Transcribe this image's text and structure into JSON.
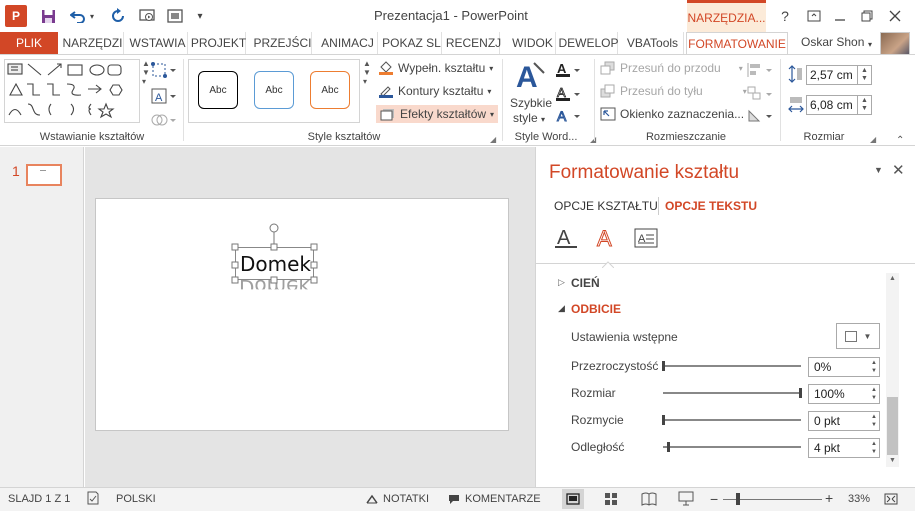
{
  "app": {
    "title": "Prezentacja1 - PowerPoint",
    "icon_letter": "P",
    "accent_color": "#d24726"
  },
  "titlebar": {
    "context_tab_header": "NARZĘDZIA...",
    "help_icon": "?",
    "user": "Oskar Shon"
  },
  "tabs": {
    "file": "PLIK",
    "items": [
      "NARZĘDZI",
      "WSTAWIA",
      "PROJEKT",
      "PRZEJŚCI",
      "ANIMACJ",
      "POKAZ SL",
      "RECENZJ",
      "WIDOK",
      "DEWELOP",
      "VBATools",
      "FORMATOWANIE"
    ],
    "active": "FORMATOWANIE"
  },
  "ribbon": {
    "groups": {
      "insert_shapes": "Wstawianie kształtów",
      "shape_styles": "Style kształtów",
      "wordart": "Style Word...",
      "arrange": "Rozmieszczanie",
      "size": "Rozmiar"
    },
    "style_boxes": [
      "Abc",
      "Abc",
      "Abc"
    ],
    "style_colors": [
      "#000000",
      "#5b9bd5",
      "#ed7d31"
    ],
    "shape_fill": "Wypełn. kształtu",
    "shape_outline": "Kontury kształtu",
    "shape_effects": "Efekty kształtów",
    "quick_styles_line1": "Szybkie",
    "quick_styles_line2": "style",
    "bring_forward": "Przesuń do przodu",
    "send_backward": "Przesuń do tyłu",
    "selection_pane": "Okienko zaznaczenia...",
    "height_value": "2,57 cm",
    "width_value": "6,08 cm"
  },
  "thumbs": {
    "slide_number": "1"
  },
  "slide": {
    "textbox_text": "Domek",
    "reflection_text": "Domek"
  },
  "pane": {
    "title": "Formatowanie kształtu",
    "tab_shape": "OPCJE KSZTAŁTU",
    "tab_text": "OPCJE TEKSTU",
    "section_shadow": "CIEŃ",
    "section_reflection": "ODBICIE",
    "presets_label": "Ustawienia wstępne",
    "transparency_label": "Przezroczystość",
    "transparency_value": "0%",
    "transparency_level": 0,
    "size_label": "Rozmiar",
    "size_value": "100%",
    "size_level": 1,
    "blur_label": "Rozmycie",
    "blur_value": "0 pkt",
    "blur_level": 0,
    "distance_label": "Odległość",
    "distance_value": "4 pkt",
    "distance_level": 0.04
  },
  "status": {
    "slide": "SLAJD 1 Z 1",
    "language": "POLSKI",
    "notes": "NOTATKI",
    "comments": "KOMENTARZE",
    "zoom": "33%",
    "zoom_level": 0.33
  }
}
